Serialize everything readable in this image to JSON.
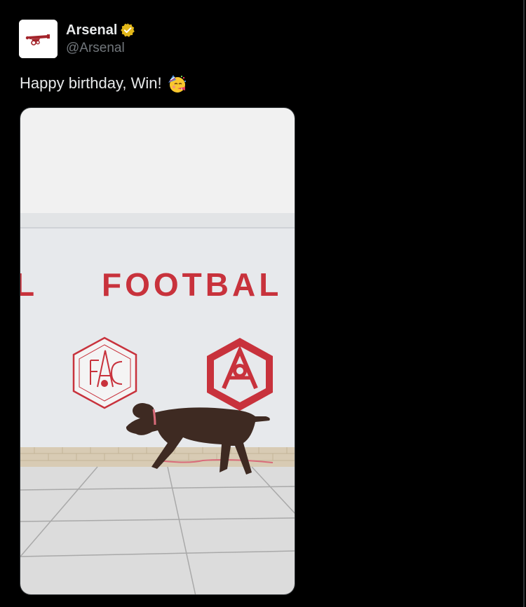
{
  "tweet": {
    "author": {
      "display_name": "Arsenal",
      "handle": "@Arsenal",
      "verified_icon": "verified-badge-icon",
      "avatar_icon": "arsenal-cannon-logo"
    },
    "text": "Happy birthday, Win!",
    "emoji": "partying-face-emoji",
    "media": {
      "wall_text": "FOOTBAL",
      "wall_text_left_fragment": "L",
      "description_icon": "video-still"
    }
  },
  "colors": {
    "background": "#000000",
    "text_primary": "#e7e9ea",
    "text_secondary": "#71767b",
    "verified_gold": "#e2b719",
    "arsenal_red": "#c8323c"
  }
}
